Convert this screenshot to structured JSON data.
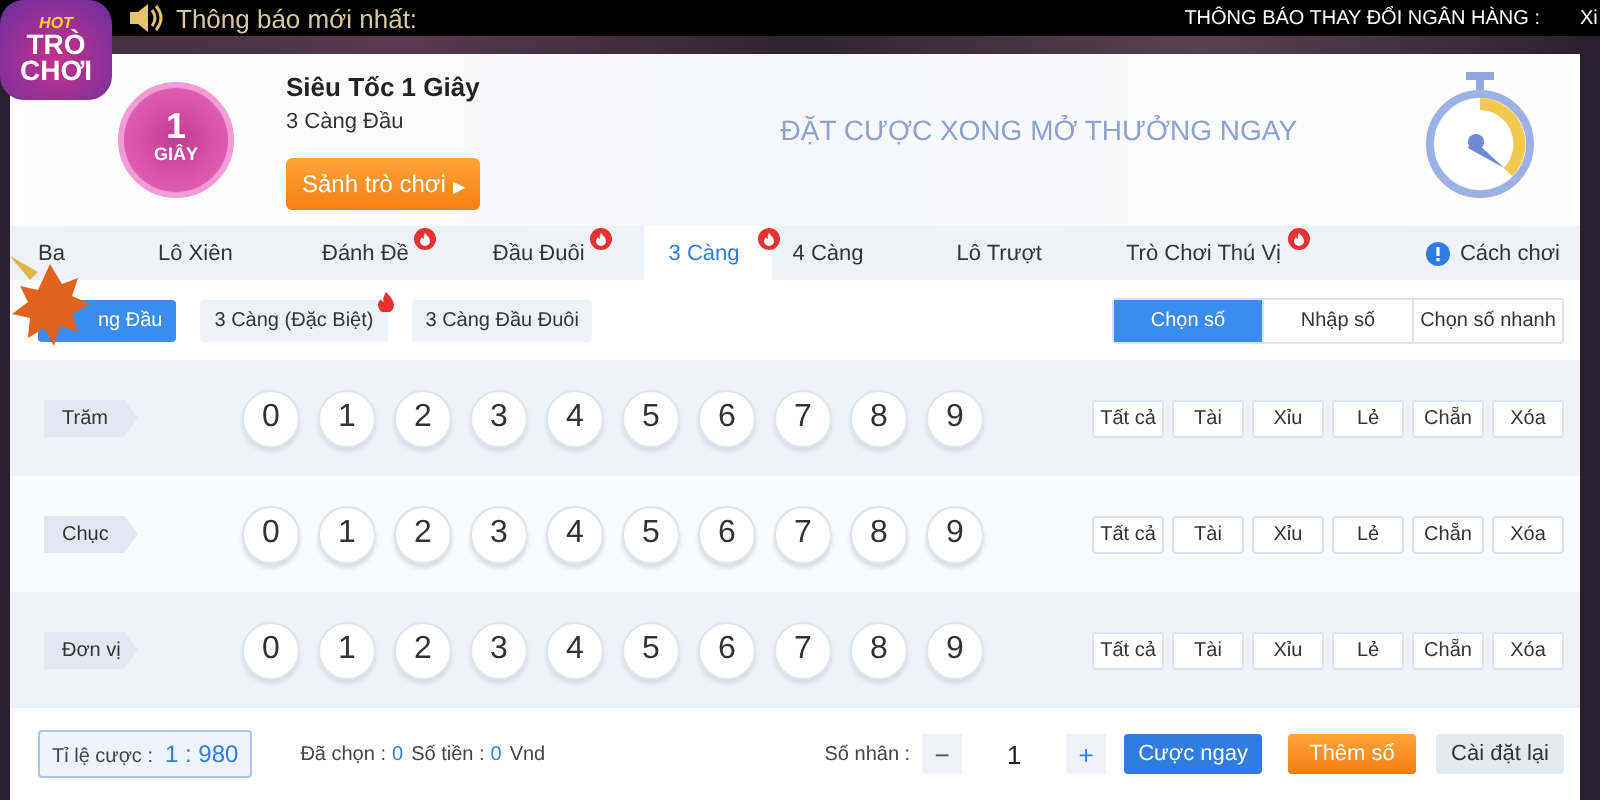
{
  "ticker": {
    "label": "Thông báo mới nhất:",
    "message": "THÔNG BÁO THAY ĐỔI NGÂN HÀNG :",
    "message_2": "Xi"
  },
  "logo": {
    "top": "HOT",
    "line_1": "TRÒ",
    "line_2": "CHƠI"
  },
  "game": {
    "badge_number": "1",
    "badge_text": "GIÂY",
    "title": "Siêu Tốc 1 Giây",
    "subtitle": "3 Càng Đầu",
    "lobby_button": "Sảnh trò chơi",
    "lobby_arrow": "▶",
    "slogan": "ĐẶT CƯỢC XONG MỞ THƯỞNG NGAY"
  },
  "tabs": [
    {
      "label": "Ba",
      "selected": false,
      "hot": false
    },
    {
      "label": "Lô Xiên",
      "selected": false,
      "hot": false
    },
    {
      "label": "Đánh Đề",
      "selected": false,
      "hot": true
    },
    {
      "label": "Đầu Đuôi",
      "selected": false,
      "hot": true
    },
    {
      "label": "3 Càng",
      "selected": true,
      "hot": true
    },
    {
      "label": "4 Càng",
      "selected": false,
      "hot": false
    },
    {
      "label": "Lô Trượt",
      "selected": false,
      "hot": false
    },
    {
      "label": "Trò Chơi Thú Vị",
      "selected": false,
      "hot": true
    }
  ],
  "help": "Cách chơi",
  "subtabs": [
    {
      "label": "ng Đầu",
      "selected": true,
      "hot": false
    },
    {
      "label": "3 Càng (Đặc Biệt)",
      "selected": false,
      "hot": true
    },
    {
      "label": "3 Càng Đầu Đuôi",
      "selected": false,
      "hot": false
    }
  ],
  "modes": [
    {
      "label": "Chọn số",
      "selected": true
    },
    {
      "label": "Nhập số",
      "selected": false
    },
    {
      "label": "Chọn số nhanh",
      "selected": false
    }
  ],
  "rows": [
    {
      "label": "Trăm",
      "digits": [
        "0",
        "1",
        "2",
        "3",
        "4",
        "5",
        "6",
        "7",
        "8",
        "9"
      ],
      "quick": [
        "Tất cả",
        "Tài",
        "Xỉu",
        "Lẻ",
        "Chẵn",
        "Xóa"
      ]
    },
    {
      "label": "Chục",
      "digits": [
        "0",
        "1",
        "2",
        "3",
        "4",
        "5",
        "6",
        "7",
        "8",
        "9"
      ],
      "quick": [
        "Tất cả",
        "Tài",
        "Xỉu",
        "Lẻ",
        "Chẵn",
        "Xóa"
      ]
    },
    {
      "label": "Đơn vị",
      "digits": [
        "0",
        "1",
        "2",
        "3",
        "4",
        "5",
        "6",
        "7",
        "8",
        "9"
      ],
      "quick": [
        "Tất cả",
        "Tài",
        "Xỉu",
        "Lẻ",
        "Chẵn",
        "Xóa"
      ]
    }
  ],
  "footer": {
    "odds_label": "Tỉ lệ cược :",
    "odds": "1 : 980",
    "chosen_label": "Đã chọn :",
    "chosen": "0",
    "amount_label": "Số tiền :",
    "amount": "0",
    "currency": "Vnd",
    "multiplier_label": "Số nhân :",
    "minus": "−",
    "multiplier": "1",
    "plus": "+",
    "buttons": [
      {
        "label": "Cược ngay",
        "kind": "primary"
      },
      {
        "label": "Thêm số",
        "kind": "accent"
      },
      {
        "label": "Cài đặt lại",
        "kind": "plain"
      }
    ]
  }
}
